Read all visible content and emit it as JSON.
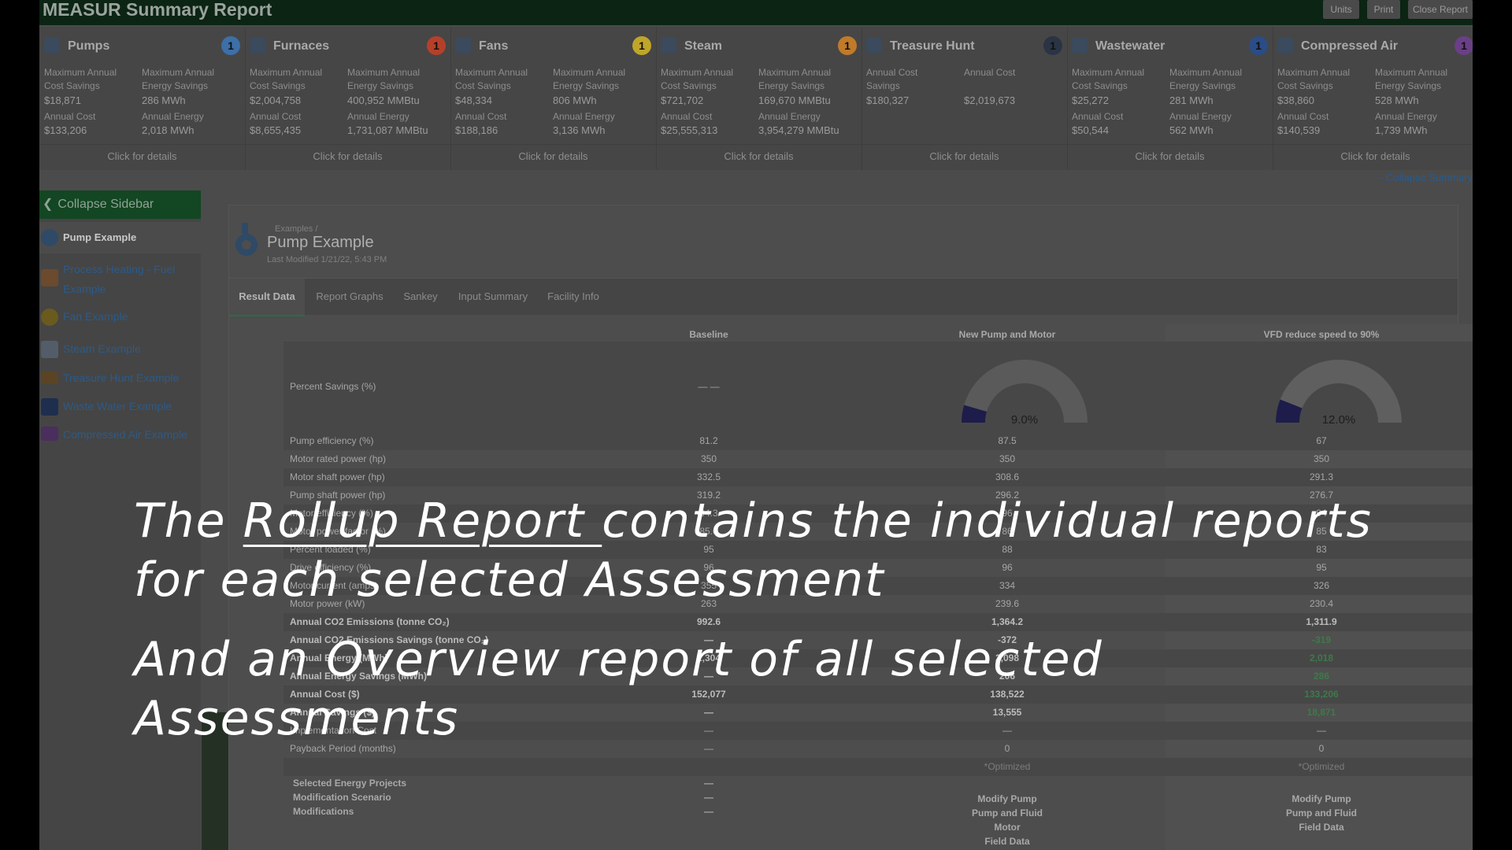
{
  "app": {
    "title": "MEASUR Summary Report",
    "buttons": [
      "Units",
      "Print",
      "Close Report"
    ]
  },
  "cards": [
    {
      "name": "Pumps",
      "badge": "1",
      "badge_color": "#3d6fa8",
      "icon": "pump-icon",
      "l1": "Maximum Annual Cost Savings",
      "v1": "$18,871",
      "l2": "Maximum Annual Energy Savings",
      "v2": "286 MWh",
      "l3": "Annual Cost",
      "v3": "$133,206",
      "l4": "Annual Energy",
      "v4": "2,018 MWh",
      "link": "Click for details"
    },
    {
      "name": "Furnaces",
      "badge": "1",
      "badge_color": "#b5402a",
      "icon": "furnace-icon",
      "l1": "Maximum Annual Cost Savings",
      "v1": "$2,004,758",
      "l2": "Maximum Annual Energy Savings",
      "v2": "400,952 MMBtu",
      "l3": "Annual Cost",
      "v3": "$8,655,435",
      "l4": "Annual Energy",
      "v4": "1,731,087 MMBtu",
      "link": "Click for details"
    },
    {
      "name": "Fans",
      "badge": "1",
      "badge_color": "#bfa62a",
      "icon": "fan-icon",
      "l1": "Maximum Annual Cost Savings",
      "v1": "$48,334",
      "l2": "Maximum Annual Energy Savings",
      "v2": "806 MWh",
      "l3": "Annual Cost",
      "v3": "$188,186",
      "l4": "Annual Energy",
      "v4": "3,136 MWh",
      "link": "Click for details"
    },
    {
      "name": "Steam",
      "badge": "1",
      "badge_color": "#c07a2a",
      "icon": "steam-icon",
      "l1": "Maximum Annual Cost Savings",
      "v1": "$721,702",
      "l2": "Maximum Annual Energy Savings",
      "v2": "169,670 MMBtu",
      "l3": "Annual Cost",
      "v3": "$25,555,313",
      "l4": "Annual Energy",
      "v4": "3,954,279 MMBtu",
      "link": "Click for details"
    },
    {
      "name": "Treasure Hunt",
      "badge": "1",
      "badge_color": "#2a3444",
      "icon": "treasure-chest-icon",
      "l1": "Annual Cost Savings",
      "v1": "$180,327",
      "l2": "Annual Cost",
      "v2": "$2,019,673",
      "l3": "",
      "v3": "",
      "l4": "",
      "v4": "",
      "link": "Click for details"
    },
    {
      "name": "Wastewater",
      "badge": "1",
      "badge_color": "#2b4c86",
      "icon": "wastewater-icon",
      "l1": "Maximum Annual Cost Savings",
      "v1": "$25,272",
      "l2": "Maximum Annual Energy Savings",
      "v2": "281 MWh",
      "l3": "Annual Cost",
      "v3": "$50,544",
      "l4": "Annual Energy",
      "v4": "562 MWh",
      "link": "Click for details"
    },
    {
      "name": "Compressed Air",
      "badge": "1",
      "badge_color": "#6a3f86",
      "icon": "compressor-icon",
      "l1": "Maximum Annual Cost Savings",
      "v1": "$38,860",
      "l2": "Maximum Annual Energy Savings",
      "v2": "528 MWh",
      "l3": "Annual Cost",
      "v3": "$140,539",
      "l4": "Annual Energy",
      "v4": "1,739 MWh",
      "link": "Click for details"
    }
  ],
  "collapse_summary": "- Collapse Summary",
  "sidebar": {
    "header": "Collapse Sidebar",
    "items": [
      "Pump Example",
      "Process Heating - Fuel Example",
      "Fan Example",
      "Steam Example",
      "Treasure Hunt Example",
      "Waste Water Example",
      "Compressed Air Example"
    ]
  },
  "main": {
    "breadcrumb": "Examples /",
    "title": "Pump Example",
    "modified": "Last Modified 1/21/22, 5:43 PM",
    "tabs": [
      "Result Data",
      "Report Graphs",
      "Sankey",
      "Input Summary",
      "Facility Info"
    ]
  },
  "table": {
    "columns": [
      "Baseline",
      "New Pump and Motor",
      "VFD reduce speed to 90%"
    ],
    "percent_label": "Percent Savings (%)",
    "percent_baseline": "— —",
    "gauges": [
      {
        "value": 9.0,
        "label": "9.0%"
      },
      {
        "value": 12.0,
        "label": "12.0%"
      }
    ],
    "rows": [
      {
        "label": "Pump efficiency (%)",
        "b": "81.2",
        "n": "87.5",
        "v": "67"
      },
      {
        "label": "Motor rated power (hp)",
        "b": "350",
        "n": "350",
        "v": "350"
      },
      {
        "label": "Motor shaft power (hp)",
        "b": "332.5",
        "n": "308.6",
        "v": "291.3"
      },
      {
        "label": "Pump shaft power (hp)",
        "b": "319.2",
        "n": "296.2",
        "v": "276.7"
      },
      {
        "label": "Motor efficiency (%)",
        "b": "94.3",
        "n": "96",
        "v": "94"
      },
      {
        "label": "Motor power factor (%)",
        "b": "85.6",
        "n": "86",
        "v": "85"
      },
      {
        "label": "Percent loaded (%)",
        "b": "95",
        "n": "88",
        "v": "83"
      },
      {
        "label": "Drive efficiency (%)",
        "b": "96",
        "n": "96",
        "v": "95"
      },
      {
        "label": "Motor current (amps)",
        "b": "355",
        "n": "334",
        "v": "326"
      },
      {
        "label": "Motor power (kW)",
        "b": "263",
        "n": "239.6",
        "v": "230.4"
      },
      {
        "label": "Annual CO2 Emissions (tonne CO₂)",
        "b": "992.6",
        "n": "1,364.2",
        "v": "1,311.9",
        "bold": true
      },
      {
        "label": "Annual CO2 Emissions Savings (tonne CO₂)",
        "b": "—",
        "n": "-372",
        "v": "-319",
        "bold": true,
        "green": true
      },
      {
        "label": "Annual Energy (MWh)",
        "b": "2,304",
        "n": "2,098",
        "v": "2,018",
        "bold": true,
        "green": true
      },
      {
        "label": "Annual Energy Savings (MWh)",
        "b": "—",
        "n": "206",
        "v": "286",
        "bold": true,
        "green": true
      },
      {
        "label": "Annual Cost ($)",
        "b": "152,077",
        "n": "138,522",
        "v": "133,206",
        "bold": true,
        "green": true
      },
      {
        "label": "Annual Savings ($)",
        "b": "—",
        "n": "13,555",
        "v": "18,871",
        "bold": true,
        "green": true
      },
      {
        "label": "Implementation Cost",
        "b": "—",
        "n": "—",
        "v": "—"
      },
      {
        "label": "Payback Period (months)",
        "b": "—",
        "n": "0",
        "v": "0"
      },
      {
        "label": "",
        "b": "",
        "n": "*Optimized",
        "v": "*Optimized",
        "opt": true
      }
    ],
    "projects_label": "Selected Energy Projects",
    "projects_b": "—",
    "scenario_label": "Modification Scenario",
    "scenario_b": "—",
    "scenario_n": "Modify Pump",
    "scenario_v": "Modify Pump",
    "mods_label": "Modifications",
    "mods_b": "—",
    "mods_n": [
      "Pump and Fluid",
      "Motor",
      "Field Data"
    ],
    "mods_v": [
      "Pump and Fluid",
      "Field Data"
    ]
  },
  "overlay": {
    "line1_a": "The ",
    "line1_link": "Rollup Report ",
    "line1_b": "contains the individual reports",
    "line2": "for each selected Assessment",
    "line3": "And an Overview report of all selected Assessments"
  }
}
